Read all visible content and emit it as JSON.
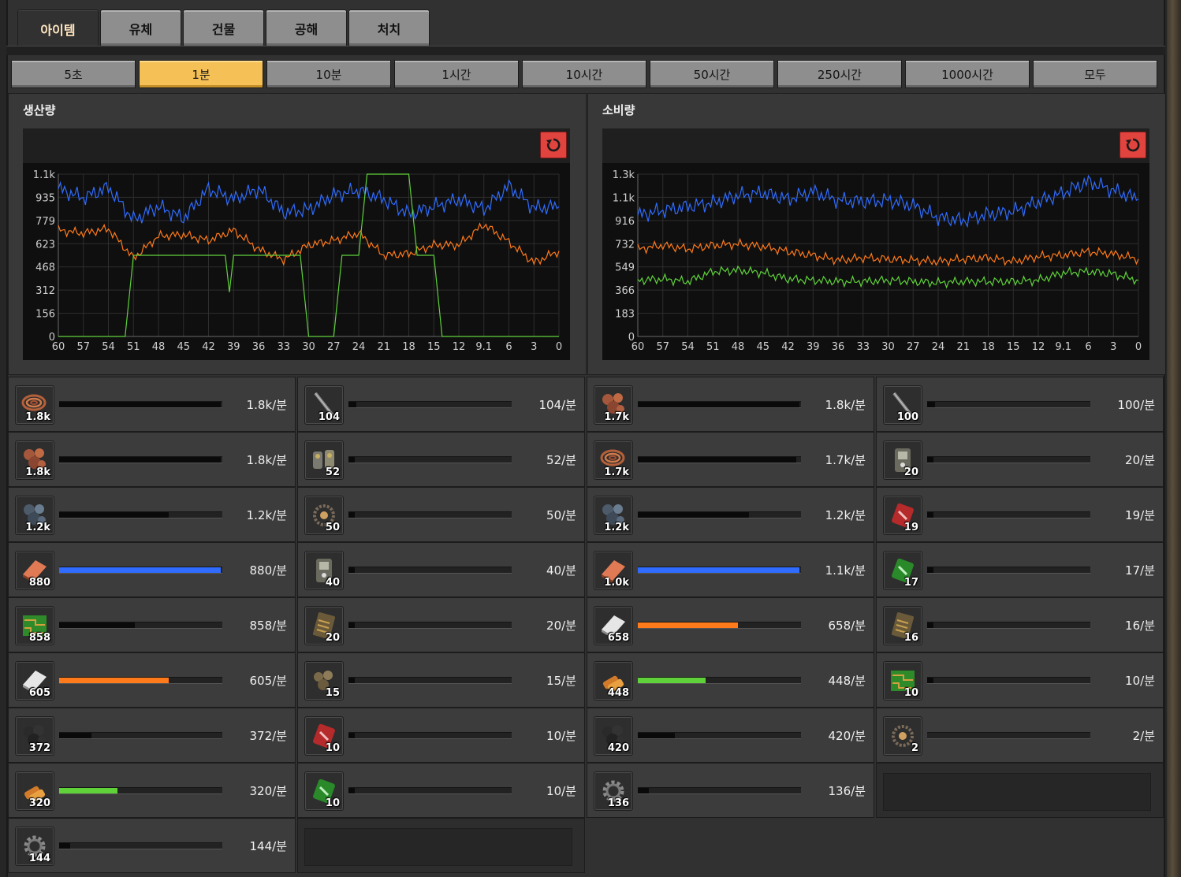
{
  "category_tabs": [
    {
      "label": "아이템",
      "active": true
    },
    {
      "label": "유체",
      "active": false
    },
    {
      "label": "건물",
      "active": false
    },
    {
      "label": "공해",
      "active": false
    },
    {
      "label": "처치",
      "active": false
    }
  ],
  "time_buttons": [
    {
      "label": "5초",
      "active": false
    },
    {
      "label": "1분",
      "active": true
    },
    {
      "label": "10분",
      "active": false
    },
    {
      "label": "1시간",
      "active": false
    },
    {
      "label": "10시간",
      "active": false
    },
    {
      "label": "50시간",
      "active": false
    },
    {
      "label": "250시간",
      "active": false
    },
    {
      "label": "1000시간",
      "active": false
    },
    {
      "label": "모두",
      "active": false
    }
  ],
  "panels": {
    "production": {
      "title": "생산량"
    },
    "consumption": {
      "title": "소비량"
    }
  },
  "colors": {
    "blue": "#2f6cff",
    "orange": "#ff7a1a",
    "green": "#5fd23a",
    "bar_black": "#0a0a0a"
  },
  "chart_data": [
    {
      "type": "line",
      "title": "생산량",
      "x_ticks": [
        "60",
        "57",
        "54",
        "51",
        "48",
        "45",
        "42",
        "39",
        "36",
        "33",
        "30",
        "27",
        "24",
        "21",
        "18",
        "15",
        "12",
        "9.1",
        "6",
        "3",
        "0"
      ],
      "y_ticks": [
        "0",
        "156",
        "312",
        "468",
        "623",
        "779",
        "935",
        "1.1k"
      ],
      "xlim": [
        60,
        0
      ],
      "ylim": [
        0,
        1100
      ],
      "grid": true,
      "series": [
        {
          "color": "blue",
          "x": [
            60,
            57,
            54,
            51,
            48,
            45,
            42,
            39,
            36,
            33,
            30,
            27,
            24,
            21,
            18,
            15,
            12,
            9,
            6,
            3,
            0
          ],
          "values": [
            1000,
            940,
            1010,
            790,
            880,
            800,
            1000,
            930,
            1000,
            840,
            860,
            960,
            990,
            930,
            830,
            880,
            930,
            860,
            1020,
            870,
            880
          ]
        },
        {
          "color": "orange",
          "x": [
            60,
            57,
            54,
            51,
            48,
            45,
            42,
            39,
            36,
            33,
            30,
            27,
            24,
            21,
            18,
            15,
            12,
            9,
            6,
            3,
            0
          ],
          "values": [
            720,
            700,
            730,
            530,
            680,
            690,
            650,
            720,
            590,
            520,
            620,
            650,
            700,
            550,
            560,
            620,
            620,
            760,
            640,
            500,
            580
          ]
        },
        {
          "color": "green",
          "x": [
            60,
            59,
            58,
            52,
            51,
            50,
            49,
            40,
            39.5,
            39,
            38,
            32,
            31,
            30,
            27,
            26,
            24,
            23,
            21,
            20,
            18,
            17,
            16,
            15,
            14,
            3,
            0
          ],
          "values": [
            0,
            0,
            0,
            0,
            550,
            550,
            550,
            550,
            300,
            550,
            550,
            550,
            550,
            0,
            0,
            550,
            550,
            1100,
            1100,
            1100,
            1100,
            550,
            550,
            550,
            0,
            0,
            0
          ]
        }
      ]
    },
    {
      "type": "line",
      "title": "소비량",
      "x_ticks": [
        "60",
        "57",
        "54",
        "51",
        "48",
        "45",
        "42",
        "39",
        "36",
        "33",
        "30",
        "27",
        "24",
        "21",
        "18",
        "15",
        "12",
        "9.1",
        "6",
        "3",
        "0"
      ],
      "y_ticks": [
        "0",
        "183",
        "366",
        "549",
        "732",
        "916",
        "1.1k",
        "1.3k"
      ],
      "xlim": [
        60,
        0
      ],
      "ylim": [
        0,
        1300
      ],
      "grid": true,
      "series": [
        {
          "color": "blue",
          "x": [
            60,
            57,
            54,
            51,
            48,
            45,
            42,
            39,
            36,
            33,
            30,
            27,
            24,
            21,
            18,
            15,
            12,
            9,
            6,
            3,
            0
          ],
          "values": [
            970,
            1010,
            1040,
            1070,
            1130,
            1150,
            1100,
            1160,
            1090,
            1080,
            1090,
            1050,
            950,
            930,
            980,
            1000,
            1080,
            1150,
            1240,
            1170,
            1100
          ]
        },
        {
          "color": "orange",
          "x": [
            60,
            57,
            54,
            51,
            48,
            45,
            42,
            39,
            36,
            33,
            30,
            27,
            24,
            21,
            18,
            15,
            12,
            9,
            6,
            3,
            0
          ],
          "values": [
            700,
            730,
            700,
            730,
            740,
            720,
            680,
            650,
            610,
            630,
            620,
            610,
            600,
            620,
            630,
            600,
            640,
            650,
            680,
            660,
            620
          ]
        },
        {
          "color": "green",
          "x": [
            60,
            57,
            54,
            51,
            48,
            45,
            42,
            39,
            36,
            33,
            30,
            27,
            24,
            21,
            18,
            15,
            12,
            9,
            6,
            3,
            0
          ],
          "values": [
            450,
            460,
            440,
            520,
            530,
            510,
            460,
            450,
            440,
            440,
            450,
            440,
            430,
            440,
            440,
            440,
            450,
            510,
            520,
            500,
            450
          ]
        }
      ]
    }
  ],
  "production_items": [
    {
      "icon": "copper-cable-icon",
      "count": "1.8k",
      "rate": "1.8k/분",
      "fill": 1.0,
      "bar": "black"
    },
    {
      "icon": "iron-stick-icon",
      "count": "104",
      "rate": "104/분",
      "fill": 0.05,
      "bar": "black"
    },
    {
      "icon": "copper-ore-icon",
      "count": "1.8k",
      "rate": "1.8k/분",
      "fill": 1.0,
      "bar": "black"
    },
    {
      "icon": "iron-gear-icon",
      "count": "52",
      "rate": "52/분",
      "fill": 0.03,
      "bar": "black"
    },
    {
      "icon": "iron-ore-icon",
      "count": "1.2k",
      "rate": "1.2k/분",
      "fill": 0.68,
      "bar": "black"
    },
    {
      "icon": "engine-unit-icon",
      "count": "50",
      "rate": "50/분",
      "fill": 0.03,
      "bar": "black"
    },
    {
      "icon": "copper-plate-icon",
      "count": "880",
      "rate": "880/분",
      "fill": 1.0,
      "bar": "blue"
    },
    {
      "icon": "inserter-icon",
      "count": "40",
      "rate": "40/분",
      "fill": 0.02,
      "bar": "black"
    },
    {
      "icon": "electronic-circuit-icon",
      "count": "858",
      "rate": "858/분",
      "fill": 0.47,
      "bar": "black"
    },
    {
      "icon": "transport-belt-icon",
      "count": "20",
      "rate": "20/분",
      "fill": 0.01,
      "bar": "black"
    },
    {
      "icon": "iron-plate-icon",
      "count": "605",
      "rate": "605/분",
      "fill": 0.68,
      "bar": "orange"
    },
    {
      "icon": "stone-icon",
      "count": "15",
      "rate": "15/분",
      "fill": 0.01,
      "bar": "black"
    },
    {
      "icon": "coal-icon",
      "count": "372",
      "rate": "372/분",
      "fill": 0.2,
      "bar": "black"
    },
    {
      "icon": "automation-science-pack-icon",
      "count": "10",
      "rate": "10/분",
      "fill": 0.01,
      "bar": "black"
    },
    {
      "icon": "copper-ingot-icon",
      "count": "320",
      "rate": "320/분",
      "fill": 0.36,
      "bar": "green"
    },
    {
      "icon": "logistic-science-pack-icon",
      "count": "10",
      "rate": "10/분",
      "fill": 0.01,
      "bar": "black"
    },
    {
      "icon": "gear-wheel-icon",
      "count": "144",
      "rate": "144/분",
      "fill": 0.07,
      "bar": "black"
    },
    null
  ],
  "consumption_items": [
    {
      "icon": "copper-ore-icon",
      "count": "1.7k",
      "rate": "1.8k/분",
      "fill": 1.0,
      "bar": "black"
    },
    {
      "icon": "iron-stick-icon",
      "count": "100",
      "rate": "100/분",
      "fill": 0.05,
      "bar": "black"
    },
    {
      "icon": "copper-cable-icon",
      "count": "1.7k",
      "rate": "1.7k/분",
      "fill": 0.98,
      "bar": "black"
    },
    {
      "icon": "inserter-icon",
      "count": "20",
      "rate": "20/분",
      "fill": 0.01,
      "bar": "black"
    },
    {
      "icon": "iron-ore-icon",
      "count": "1.2k",
      "rate": "1.2k/분",
      "fill": 0.69,
      "bar": "black"
    },
    {
      "icon": "automation-science-pack-icon",
      "count": "19",
      "rate": "19/분",
      "fill": 0.01,
      "bar": "black"
    },
    {
      "icon": "copper-plate-icon",
      "count": "1.0k",
      "rate": "1.1k/분",
      "fill": 1.0,
      "bar": "blue"
    },
    {
      "icon": "logistic-science-pack-icon",
      "count": "17",
      "rate": "17/분",
      "fill": 0.01,
      "bar": "black"
    },
    {
      "icon": "iron-plate-icon",
      "count": "658",
      "rate": "658/분",
      "fill": 0.62,
      "bar": "orange"
    },
    {
      "icon": "transport-belt-icon",
      "count": "16",
      "rate": "16/분",
      "fill": 0.01,
      "bar": "black"
    },
    {
      "icon": "copper-ingot-icon",
      "count": "448",
      "rate": "448/분",
      "fill": 0.42,
      "bar": "green"
    },
    {
      "icon": "electronic-circuit-icon",
      "count": "10",
      "rate": "10/분",
      "fill": 0.01,
      "bar": "black"
    },
    {
      "icon": "coal-icon",
      "count": "420",
      "rate": "420/분",
      "fill": 0.23,
      "bar": "black"
    },
    {
      "icon": "engine-unit-icon",
      "count": "2",
      "rate": "2/분",
      "fill": 0.0,
      "bar": "black"
    },
    {
      "icon": "gear-wheel-icon",
      "count": "136",
      "rate": "136/분",
      "fill": 0.07,
      "bar": "black"
    },
    null
  ]
}
